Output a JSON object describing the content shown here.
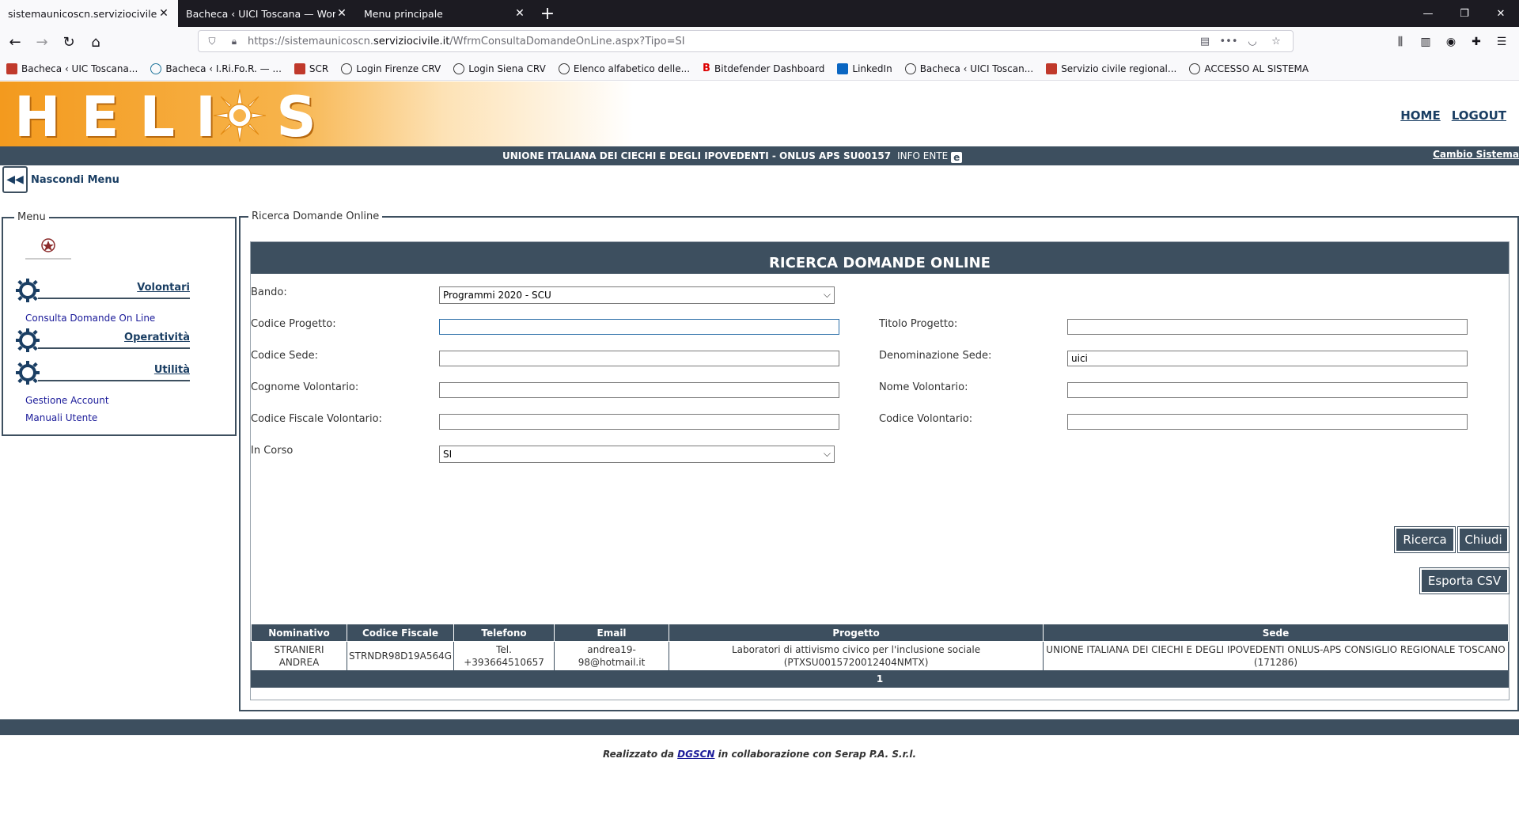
{
  "browser": {
    "tabs": [
      {
        "title": "sistemaunicoscn.serviziocivile.it/Wf",
        "active": true
      },
      {
        "title": "Bacheca ‹ UICI Toscana — WordPre",
        "active": false
      },
      {
        "title": "Menu principale",
        "active": false
      }
    ],
    "url_prefix": "https://sistemaunicoscn.",
    "url_domain": "serviziocivile.it",
    "url_path": "/WfrmConsultaDomandeOnLine.aspx?Tipo=SI",
    "bookmarks": [
      {
        "label": "Bacheca ‹ UIC Toscana...",
        "icon": "red"
      },
      {
        "label": "Bacheca ‹ I.Ri.Fo.R. — ...",
        "icon": "wp"
      },
      {
        "label": "SCR",
        "icon": "red"
      },
      {
        "label": "Login Firenze CRV",
        "icon": "globe"
      },
      {
        "label": "Login Siena CRV",
        "icon": "globe"
      },
      {
        "label": "Elenco alfabetico delle...",
        "icon": "globe"
      },
      {
        "label": "Bitdefender Dashboard",
        "icon": "bd"
      },
      {
        "label": "LinkedIn",
        "icon": "li"
      },
      {
        "label": "Bacheca ‹ UICI Toscan...",
        "icon": "globe"
      },
      {
        "label": "Servizio civile regional...",
        "icon": "red"
      },
      {
        "label": "ACCESSO AL SISTEMA",
        "icon": "globe"
      }
    ]
  },
  "header": {
    "logo_text": "HELI S",
    "home": "HOME",
    "logout": "LOGOUT",
    "ente": "UNIONE ITALIANA DEI CIECHI E DEGLI IPOVEDENTI - ONLUS APS  SU00157",
    "info_ente": "INFO ENTE",
    "info_icon": "e",
    "cambio": "Cambio Sistema",
    "hide_menu": "Nascondi Menu"
  },
  "menu": {
    "legend": "Menu",
    "groups": [
      {
        "title": "Volontari",
        "items": [
          "Consulta Domande On Line"
        ]
      },
      {
        "title": "Operatività",
        "items": []
      },
      {
        "title": "Utilità",
        "items": [
          "Gestione Account",
          "Manuali Utente"
        ]
      }
    ]
  },
  "main": {
    "legend": "Ricerca Domande Online",
    "title": "RICERCA DOMANDE ONLINE",
    "fields": {
      "bando": {
        "label": "Bando:",
        "value": "Programmi 2020 - SCU"
      },
      "codice_progetto": {
        "label": "Codice Progetto:",
        "value": ""
      },
      "titolo_progetto": {
        "label": "Titolo Progetto:",
        "value": ""
      },
      "codice_sede": {
        "label": "Codice Sede:",
        "value": ""
      },
      "denominazione_sede": {
        "label": "Denominazione Sede:",
        "value": "uici"
      },
      "cognome_volontario": {
        "label": "Cognome Volontario:",
        "value": ""
      },
      "nome_volontario": {
        "label": "Nome Volontario:",
        "value": ""
      },
      "codice_fiscale": {
        "label": "Codice Fiscale Volontario:",
        "value": ""
      },
      "codice_volontario": {
        "label": "Codice Volontario:",
        "value": ""
      },
      "in_corso": {
        "label": "In Corso",
        "value": "SI"
      }
    },
    "buttons": {
      "ricerca": "Ricerca",
      "chiudi": "Chiudi",
      "esporta": "Esporta CSV"
    },
    "table": {
      "columns": [
        "Nominativo",
        "Codice Fiscale",
        "Telefono",
        "Email",
        "Progetto",
        "Sede"
      ],
      "rows": [
        [
          "STRANIERI ANDREA",
          "STRNDR98D19A564G",
          "Tel. +393664510657",
          "andrea19-98@hotmail.it",
          "Laboratori di attivismo civico per l'inclusione sociale (PTXSU0015720012404NMTX)",
          "UNIONE ITALIANA DEI CIECHI E DEGLI IPOVEDENTI ONLUS-APS CONSIGLIO REGIONALE TOSCANO (171286)"
        ]
      ],
      "pager": "1"
    }
  },
  "footer": {
    "prefix": "Realizzato da ",
    "link": "DGSCN",
    "suffix": " in collaborazione con Serap P.A. S.r.l."
  }
}
